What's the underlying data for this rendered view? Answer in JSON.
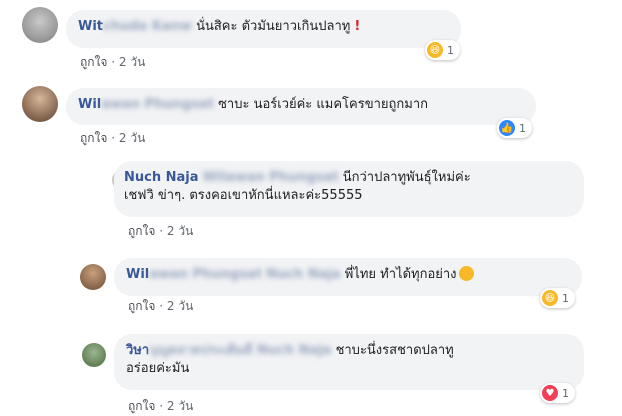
{
  "comments": [
    {
      "author_visible": "Wit",
      "author_blurred": "chuda Kanw",
      "text": "นั่นสิคะ ตัวมันยาวเกินปลาทู",
      "like_label": "ถูกใจ",
      "separator": "·",
      "time": "2 วัน",
      "reaction_count": "1",
      "reaction_icon": "haha-icon"
    },
    {
      "author_visible": "Wil",
      "author_blurred": "awan Phungsat",
      "text": "ซาบะ นอร์เวย์ค่ะ แมคโครขายถูกมาก",
      "like_label": "ถูกใจ",
      "separator": "·",
      "time": "2 วัน",
      "reaction_count": "1",
      "reaction_icon": "like-icon"
    }
  ],
  "replies": [
    {
      "author": "Nuch Naja",
      "tag_blurred": "Wilawan Phungsat",
      "text_line1": "นีกว่าปลาทูพันธุ์ใหม่ค่ะ",
      "text_line2": "เชฟวิ ข่าๆ. ตรงคอเขาหักนี่แหละค่ะ55555",
      "like_label": "ถูกใจ",
      "separator": "·",
      "time": "2 วัน"
    },
    {
      "author_visible": "Wil",
      "author_blurred": "awan Phungsat",
      "tag_blurred": "Nuch Naja",
      "text": "พี่ไทย ทำได้ทุกอย่าง",
      "like_label": "ถูกใจ",
      "separator": "·",
      "time": "2 วัน",
      "reaction_count": "1",
      "reaction_icon": "haha-icon"
    },
    {
      "author_visible": "วิษา",
      "author_blurred": "บุญตลาดประเดิมดี",
      "tag_blurred": "Nuch Naja",
      "text_line1": "ชาบะนึ่งรสชาดปลาทู",
      "text_line2": "อร่อยค่ะมัน",
      "like_label": "ถูกใจ",
      "separator": "·",
      "time": "2 วัน",
      "reaction_count": "1",
      "reaction_icon": "love-icon"
    }
  ]
}
